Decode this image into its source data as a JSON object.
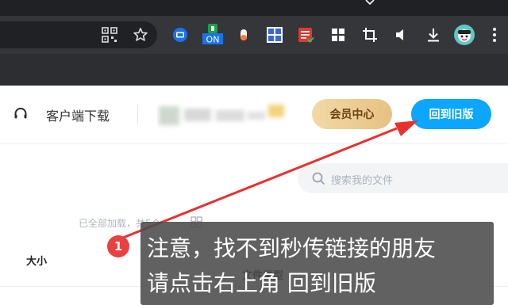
{
  "browser": {
    "toolbar_icons": [
      {
        "name": "qr-code-icon"
      },
      {
        "name": "bookmark-star-icon"
      },
      {
        "name": "screen-extension-icon"
      },
      {
        "name": "toggle-on-extension-icon",
        "label": "ON"
      },
      {
        "name": "capsule-extension-icon"
      },
      {
        "name": "grid-extension-icon"
      },
      {
        "name": "doc-extension-icon"
      },
      {
        "name": "windows-grid-icon"
      },
      {
        "name": "crop-icon"
      },
      {
        "name": "volume-icon"
      },
      {
        "name": "download-icon"
      },
      {
        "name": "profile-avatar-icon"
      },
      {
        "name": "more-menu-icon"
      }
    ]
  },
  "header": {
    "client_download": "客户端下载",
    "member_center": "会员中心",
    "back_to_old": "回到旧版"
  },
  "search": {
    "placeholder": "搜索我的文件"
  },
  "files": {
    "loaded_status": "已全部加载，共5个",
    "col_size": "大小",
    "col_type": "文件类型"
  },
  "annotation": {
    "badge": "1",
    "line1": "注意，找不到秒传链接的朋友",
    "line2": "请点击右上角 回到旧版"
  },
  "colors": {
    "accent_blue": "#0aa6ff",
    "member_gold": "#e7c183",
    "badge_red": "#e94040",
    "arrow_red": "#e8312f"
  }
}
